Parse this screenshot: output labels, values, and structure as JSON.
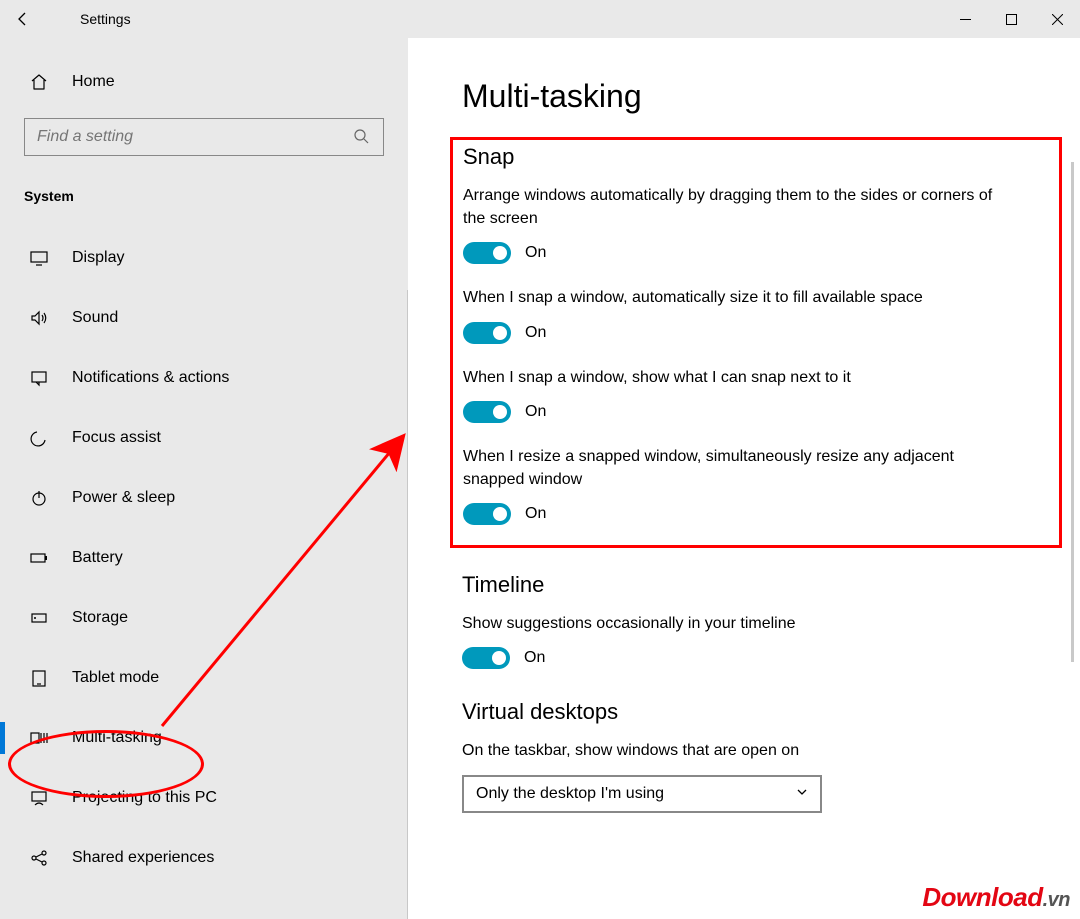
{
  "titlebar": {
    "title": "Settings"
  },
  "home": {
    "label": "Home"
  },
  "search": {
    "placeholder": "Find a setting"
  },
  "section_label": "System",
  "nav": [
    {
      "key": "display",
      "label": "Display"
    },
    {
      "key": "sound",
      "label": "Sound"
    },
    {
      "key": "notifications",
      "label": "Notifications & actions"
    },
    {
      "key": "focus-assist",
      "label": "Focus assist"
    },
    {
      "key": "power-sleep",
      "label": "Power & sleep"
    },
    {
      "key": "battery",
      "label": "Battery"
    },
    {
      "key": "storage",
      "label": "Storage"
    },
    {
      "key": "tablet-mode",
      "label": "Tablet mode"
    },
    {
      "key": "multitasking",
      "label": "Multi-tasking",
      "selected": true
    },
    {
      "key": "projecting",
      "label": "Projecting to this PC"
    },
    {
      "key": "shared-experiences",
      "label": "Shared experiences"
    }
  ],
  "page": {
    "title": "Multi-tasking",
    "snap": {
      "heading": "Snap",
      "items": [
        {
          "desc": "Arrange windows automatically by dragging them to the sides or corners of the screen",
          "state": "On"
        },
        {
          "desc": "When I snap a window, automatically size it to fill available space",
          "state": "On"
        },
        {
          "desc": "When I snap a window, show what I can snap next to it",
          "state": "On"
        },
        {
          "desc": "When I resize a snapped window, simultaneously resize any adjacent snapped window",
          "state": "On"
        }
      ]
    },
    "timeline": {
      "heading": "Timeline",
      "desc": "Show suggestions occasionally in your timeline",
      "state": "On"
    },
    "virtual": {
      "heading": "Virtual desktops",
      "desc": "On the taskbar, show windows that are open on",
      "select_value": "Only the desktop I'm using"
    }
  },
  "watermark": {
    "brand": "Download",
    "tld": ".vn"
  }
}
